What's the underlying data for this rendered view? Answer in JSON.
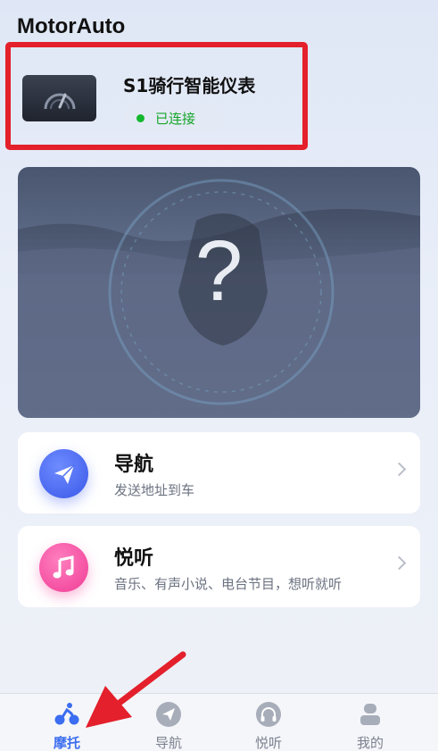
{
  "app": {
    "title": "MotorAuto"
  },
  "device": {
    "name": "S1骑行智能仪表",
    "status": "已连接",
    "status_color": "#14b82e"
  },
  "hero": {
    "placeholder": "?"
  },
  "menu": [
    {
      "title": "导航",
      "subtitle": "发送地址到车",
      "icon": "paper-plane-icon",
      "color": "#4a6bf0"
    },
    {
      "title": "悦听",
      "subtitle": "音乐、有声小说、电台节目，想听就听",
      "icon": "music-note-icon",
      "color": "#f0479c"
    }
  ],
  "tabs": [
    {
      "label": "摩托",
      "icon": "motorcycle-rider-icon",
      "active": true
    },
    {
      "label": "导航",
      "icon": "navigation-icon",
      "active": false
    },
    {
      "label": "悦听",
      "icon": "headphones-icon",
      "active": false
    },
    {
      "label": "我的",
      "icon": "user-icon",
      "active": false
    }
  ],
  "colors": {
    "accent": "#3b6df0",
    "highlight": "#e3202b"
  }
}
